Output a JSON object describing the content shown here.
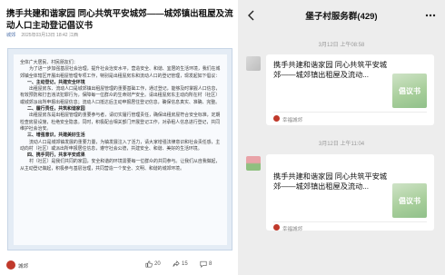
{
  "article": {
    "title": "携手共建和谐家园 同心共筑平安城郊——城郊镇出租屋及流动人口主动登记倡议书",
    "account": "城郊",
    "date": "2025年03月13日 18:42 江西",
    "doc_paragraphs": [
      {
        "type": "p",
        "text": "全体广大居民、村民朋友们："
      },
      {
        "type": "ind",
        "text": "为了进一步加强基层社会治理，提升社会治安水平，营造安全、和谐、宜居的生活环境，我们在城郊镇全体辖区开展出租屋管理专项工作，特别是出租屋房东和流动人口的登记管理，现发起如下倡议："
      },
      {
        "type": "h",
        "text": "一、主动登记，共建安全环境"
      },
      {
        "type": "ind",
        "text": "出租屋房东、流动人口是城郊镇出租屋管理的重要基础工作，通过登记，能够及时掌握人口信息，有效预防和打击违法犯罪行为，保障每一位群众的生命财产安全。请出租屋房东主动向所在村（社区）或城郊派出所申报出租屋信息；流动人口抵达后主动申报居住登记信息，确保信息真实、准确、完整。"
      },
      {
        "type": "h",
        "text": "二、履行责任，共筑和谐家园"
      },
      {
        "type": "ind",
        "text": "出租屋房东是出租屋管理的重要参与者，请切实履行管理责任，确保出租房屋符合安全标准，定期检查房屋设施，杜绝安全隐患。同时，积极配合相关部门开展登记工作，对承租人信息进行登记，共同维护社会治安。"
      },
      {
        "type": "h",
        "text": "三、增强意识，共建美好生活"
      },
      {
        "type": "ind",
        "text": "流动人口是城郊镇发展的重要力量，为镇发展注入了活力，请大家增强法律意识和社会责任感，主动向村（社区）或派出所申报居住信息，遵守社会公德，共建安全、和谐、美好的生活环境。"
      },
      {
        "type": "h",
        "text": "四、携手同行，共享平安成果"
      },
      {
        "type": "ind",
        "text": "村（社区）是我们共同的家园，安全和谐的环境需要每一位群众的共同参与。让我们从自我做起，从主动登记做起，积极参与基层治理，共同营造一个安全、文明、和谐的城郊环境。"
      }
    ],
    "author": "城郊",
    "stats": {
      "likes": "20",
      "shares": "15",
      "comments": "8"
    }
  },
  "chat": {
    "group_title": "堡子村服务群(429)",
    "messages": [
      {
        "timestamp": "3月12日 上午08:58",
        "card_title": "携手共建和谐家园 同心共筑平安城郊——城郊镇出租屋及流动...",
        "thumb_text": "倡议书",
        "source": "幸福城郊"
      },
      {
        "timestamp": "3月12日 上午11:04",
        "card_title": "携手共建和谐家园 同心共筑平安城郊——城郊镇出租屋及流动...",
        "thumb_text": "倡议书",
        "source": "幸福城郊"
      }
    ]
  },
  "colors": {
    "link_blue": "#4a6ea8",
    "chat_bg": "#ededed",
    "thumb_green": "#a9cf9c"
  }
}
